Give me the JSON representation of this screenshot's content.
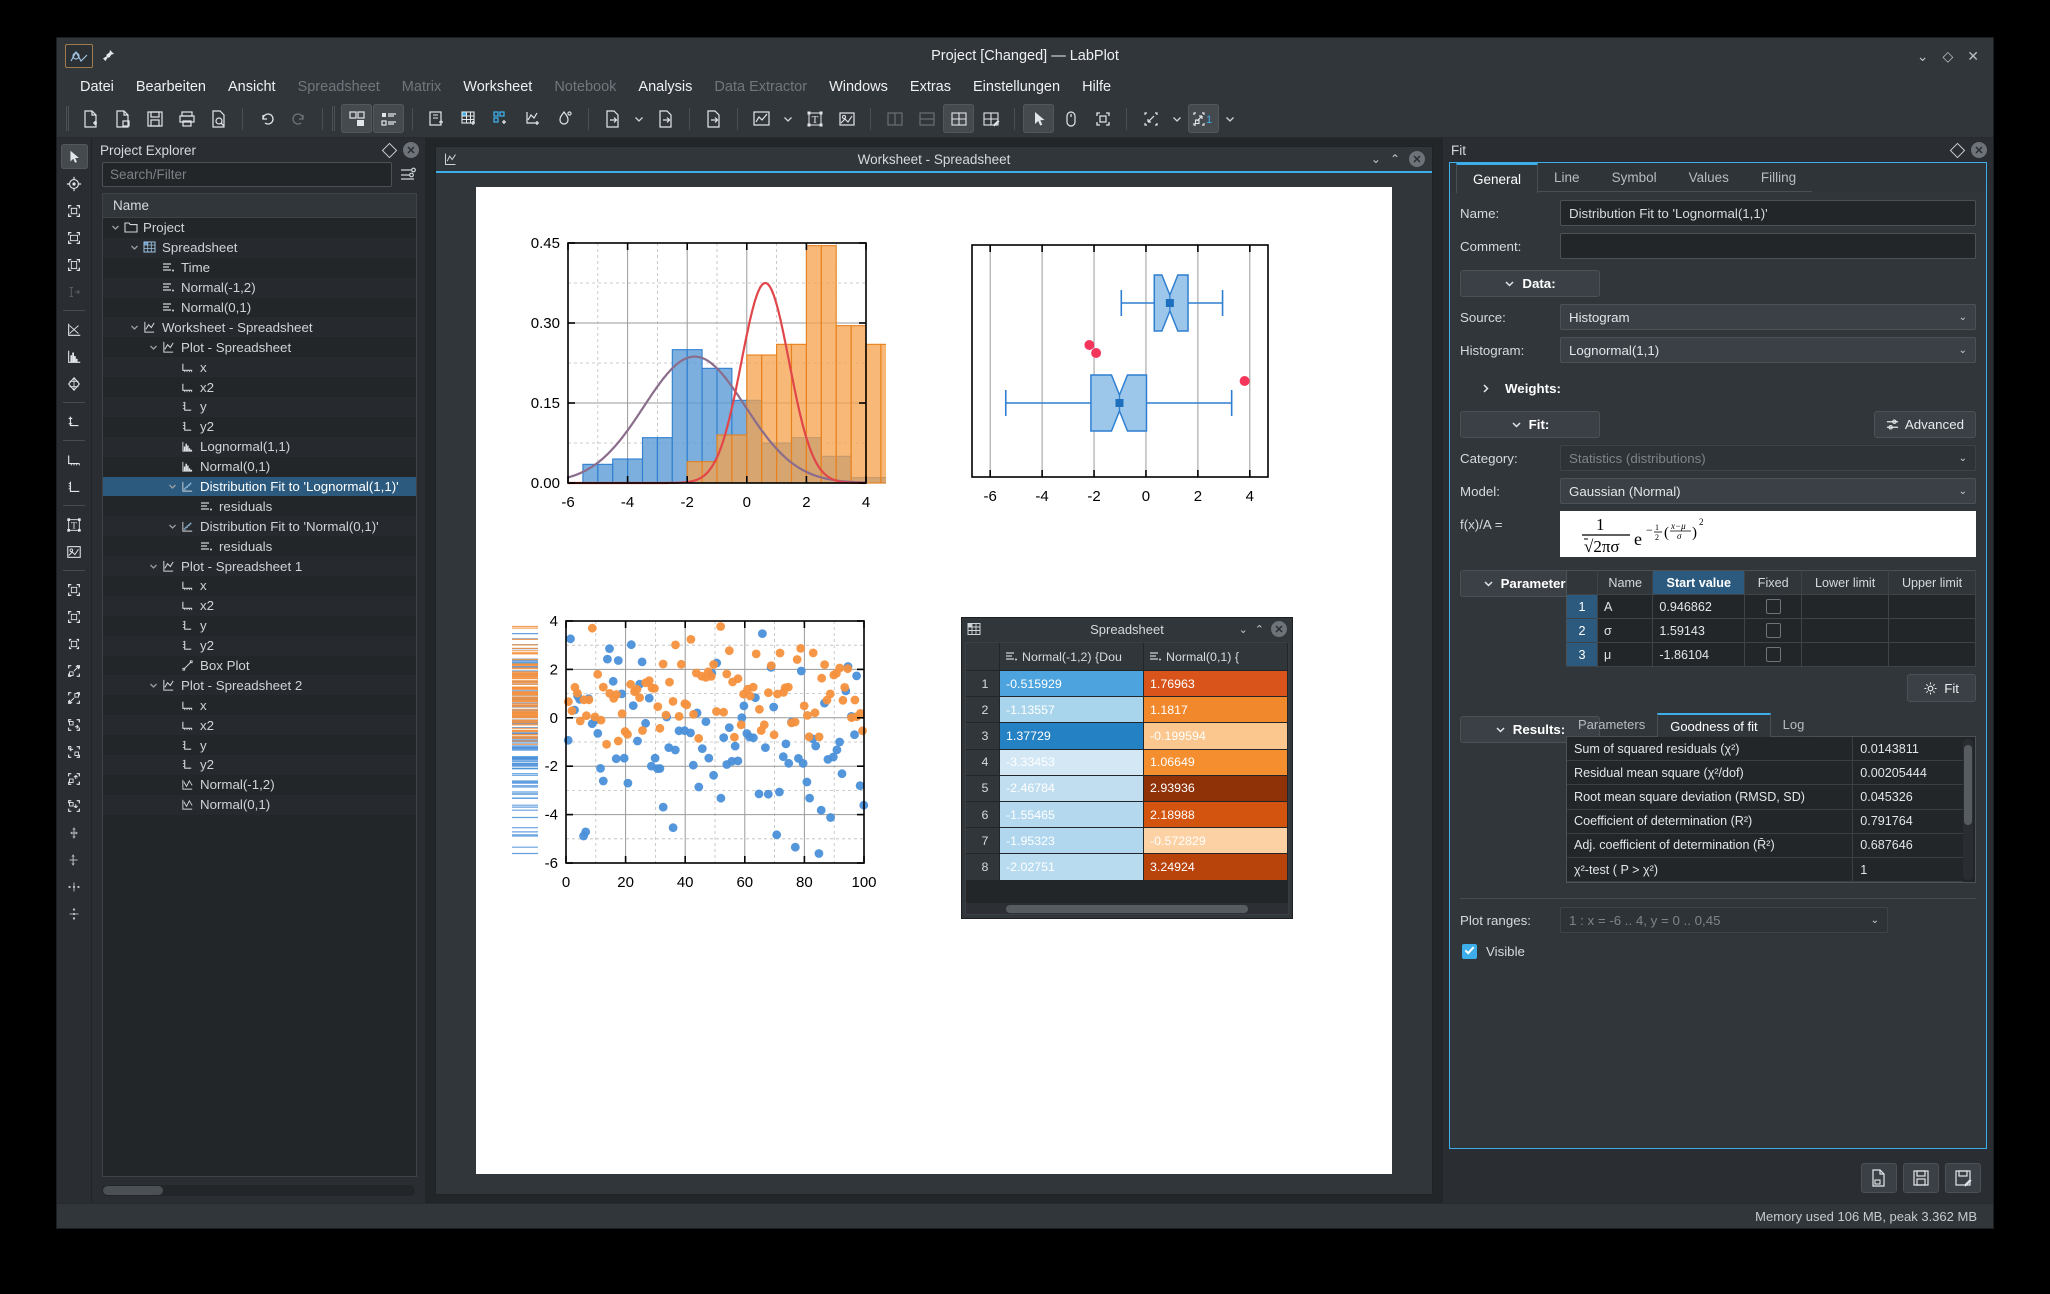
{
  "window": {
    "title": "Project [Changed] — LabPlot",
    "logo_icon": "labplot-logo-icon",
    "pin_icon": "pin-icon",
    "min_label": "⌄",
    "restore_label": "◇",
    "close_label": "✕"
  },
  "menubar": {
    "items": [
      {
        "label": "Datei",
        "enabled": true
      },
      {
        "label": "Bearbeiten",
        "enabled": true
      },
      {
        "label": "Ansicht",
        "enabled": true
      },
      {
        "label": "Spreadsheet",
        "enabled": false
      },
      {
        "label": "Matrix",
        "enabled": false
      },
      {
        "label": "Worksheet",
        "enabled": true
      },
      {
        "label": "Notebook",
        "enabled": false
      },
      {
        "label": "Analysis",
        "enabled": true
      },
      {
        "label": "Data Extractor",
        "enabled": false
      },
      {
        "label": "Windows",
        "enabled": true
      },
      {
        "label": "Extras",
        "enabled": true
      },
      {
        "label": "Einstellungen",
        "enabled": true
      },
      {
        "label": "Hilfe",
        "enabled": true
      }
    ]
  },
  "toolbar": {
    "items": [
      "new-project-icon",
      "open-project-icon",
      "save-icon",
      "print-icon",
      "print-preview-icon",
      "undo-icon",
      "redo-icon",
      "project-explorer-toggle-icon",
      "properties-explorer-toggle-icon",
      "new-workbook-icon",
      "new-spreadsheet-icon",
      "new-matrix-icon",
      "new-worksheet-icon",
      "new-notebook-icon",
      "import-file-icon",
      "import-dropdown-icon",
      "export-icon",
      "export-worksheet-icon",
      "add-plot-icon",
      "add-plot-dropdown-icon",
      "add-text-label-icon",
      "add-image-icon",
      "layout-vertical-icon",
      "layout-horizontal-icon",
      "layout-grid-icon",
      "layout-edit-icon",
      "select-mode-icon",
      "navigate-mode-icon",
      "zoom-select-mode-icon",
      "zoom-fit-icon",
      "zoom-fit-dropdown-icon",
      "magnification-icon",
      "magnification-dropdown-icon"
    ],
    "magnification_value": "1"
  },
  "left_toolbar": {
    "items": [
      "cursor-select-icon",
      "crosshair-icon",
      "select-region-icon",
      "select-x-region-icon",
      "select-y-region-icon",
      "text-cursor-icon",
      "add-xy-curve-icon",
      "add-histogram-icon",
      "add-qq-plot-icon",
      "add-bar-plot-icon",
      "add-axis-horizontal-icon",
      "add-axis-vertical-icon",
      "add-text-label-icon",
      "add-image-icon",
      "zoom-fit-icon",
      "zoom-in-icon",
      "zoom-out-icon",
      "shift-right-icon",
      "shift-left-icon",
      "shift-up-icon",
      "shift-down-icon",
      "expand-x-icon",
      "shrink-x-icon",
      "expand-y-icon",
      "shrink-y-icon",
      "align-center-icon",
      "align-middle-icon",
      "distribute-h-icon",
      "distribute-v-icon"
    ]
  },
  "project_explorer": {
    "title": "Project Explorer",
    "search_placeholder": "Search/Filter",
    "filter_icon": "filter-options-icon",
    "column_header": "Name",
    "tree": [
      {
        "label": "Project",
        "depth": 0,
        "icon": "folder-icon",
        "expander": "down",
        "selected": false
      },
      {
        "label": "Spreadsheet",
        "depth": 1,
        "icon": "spreadsheet-icon",
        "expander": "down",
        "selected": false
      },
      {
        "label": "Time",
        "depth": 2,
        "icon": "column-icon",
        "expander": "",
        "selected": false
      },
      {
        "label": "Normal(-1,2)",
        "depth": 2,
        "icon": "column-icon",
        "expander": "",
        "selected": false
      },
      {
        "label": "Normal(0,1)",
        "depth": 2,
        "icon": "column-icon",
        "expander": "",
        "selected": false
      },
      {
        "label": "Worksheet - Spreadsheet",
        "depth": 1,
        "icon": "worksheet-icon",
        "expander": "down",
        "selected": false
      },
      {
        "label": "Plot - Spreadsheet",
        "depth": 2,
        "icon": "plot-icon",
        "expander": "down",
        "selected": false
      },
      {
        "label": "x",
        "depth": 3,
        "icon": "axis-h-icon",
        "expander": "",
        "selected": false
      },
      {
        "label": "x2",
        "depth": 3,
        "icon": "axis-h-icon",
        "expander": "",
        "selected": false
      },
      {
        "label": "y",
        "depth": 3,
        "icon": "axis-v-icon",
        "expander": "",
        "selected": false
      },
      {
        "label": "y2",
        "depth": 3,
        "icon": "axis-v-icon",
        "expander": "",
        "selected": false
      },
      {
        "label": "Lognormal(1,1)",
        "depth": 3,
        "icon": "histogram-icon",
        "expander": "",
        "selected": false
      },
      {
        "label": "Normal(0,1)",
        "depth": 3,
        "icon": "histogram-icon",
        "expander": "",
        "selected": false
      },
      {
        "label": "Distribution Fit to 'Lognormal(1,1)'",
        "depth": 3,
        "icon": "fit-curve-icon",
        "expander": "down",
        "selected": true
      },
      {
        "label": "residuals",
        "depth": 4,
        "icon": "column-icon",
        "expander": "",
        "selected": false
      },
      {
        "label": "Distribution Fit to 'Normal(0,1)'",
        "depth": 3,
        "icon": "fit-curve-icon",
        "expander": "down",
        "selected": false
      },
      {
        "label": "residuals",
        "depth": 4,
        "icon": "column-icon",
        "expander": "",
        "selected": false
      },
      {
        "label": "Plot - Spreadsheet 1",
        "depth": 2,
        "icon": "plot-icon",
        "expander": "down",
        "selected": false
      },
      {
        "label": "x",
        "depth": 3,
        "icon": "axis-h-icon",
        "expander": "",
        "selected": false
      },
      {
        "label": "x2",
        "depth": 3,
        "icon": "axis-h-icon",
        "expander": "",
        "selected": false
      },
      {
        "label": "y",
        "depth": 3,
        "icon": "axis-v-icon",
        "expander": "",
        "selected": false
      },
      {
        "label": "y2",
        "depth": 3,
        "icon": "axis-v-icon",
        "expander": "",
        "selected": false
      },
      {
        "label": "Box Plot",
        "depth": 3,
        "icon": "box-plot-icon",
        "expander": "",
        "selected": false
      },
      {
        "label": "Plot - Spreadsheet 2",
        "depth": 2,
        "icon": "plot-icon",
        "expander": "down",
        "selected": false
      },
      {
        "label": "x",
        "depth": 3,
        "icon": "axis-h-icon",
        "expander": "",
        "selected": false
      },
      {
        "label": "x2",
        "depth": 3,
        "icon": "axis-h-icon",
        "expander": "",
        "selected": false
      },
      {
        "label": "y",
        "depth": 3,
        "icon": "axis-v-icon",
        "expander": "",
        "selected": false
      },
      {
        "label": "y2",
        "depth": 3,
        "icon": "axis-v-icon",
        "expander": "",
        "selected": false
      },
      {
        "label": "Normal(-1,2)",
        "depth": 3,
        "icon": "scatter-icon",
        "expander": "",
        "selected": false
      },
      {
        "label": "Normal(0,1)",
        "depth": 3,
        "icon": "scatter-icon",
        "expander": "",
        "selected": false
      }
    ]
  },
  "worksheet_window": {
    "title": "Worksheet - Spreadsheet",
    "icon": "worksheet-icon",
    "minimize": "⌄",
    "maximize": "⌃",
    "close": "✕"
  },
  "spreadsheet_window": {
    "title": "Spreadsheet",
    "icon": "spreadsheet-icon",
    "minimize": "⌄",
    "maximize": "⌃",
    "close": "✕",
    "columns": [
      "Normal(-1,2) {Dou",
      "Normal(0,1) {"
    ],
    "rows": [
      {
        "n": "1",
        "a": "-0.515929",
        "b": "1.76963",
        "ca": "#4ca3dd",
        "cb": "#d9541b",
        "ta": "#ffffff",
        "tb": "#ffffff"
      },
      {
        "n": "2",
        "a": "-1.13557",
        "b": "1.1817",
        "ca": "#a9d5ec",
        "cb": "#f2882c",
        "ta": "#ffffff",
        "tb": "#ffffff"
      },
      {
        "n": "3",
        "a": "1.37729",
        "b": "-0.199594",
        "ca": "#2481c4",
        "cb": "#fbc78e",
        "ta": "#ffffff",
        "tb": "#ffffff"
      },
      {
        "n": "4",
        "a": "-3.33453",
        "b": "1.06649",
        "ca": "#d3e7f4",
        "cb": "#f58e2e",
        "ta": "#ffffff",
        "tb": "#ffffff"
      },
      {
        "n": "5",
        "a": "-2.46784",
        "b": "2.93936",
        "ca": "#c0def0",
        "cb": "#8f3208",
        "ta": "#ffffff",
        "tb": "#ffffff"
      },
      {
        "n": "6",
        "a": "-1.55465",
        "b": "2.18988",
        "ca": "#b4d9ee",
        "cb": "#d2540f",
        "ta": "#ffffff",
        "tb": "#ffffff"
      },
      {
        "n": "7",
        "a": "-1.95323",
        "b": "-0.572829",
        "ca": "#b0d7ed",
        "cb": "#fcd1a4",
        "ta": "#ffffff",
        "tb": "#ffffff"
      },
      {
        "n": "8",
        "a": "-2.02751",
        "b": "3.24924",
        "ca": "#b8dbef",
        "cb": "#b8430b",
        "ta": "#ffffff",
        "tb": "#ffffff"
      }
    ]
  },
  "fit_panel": {
    "title": "Fit",
    "float_icon": "float-icon",
    "close_icon": "close-icon",
    "tabs": [
      {
        "label": "General",
        "active": true
      },
      {
        "label": "Line",
        "active": false
      },
      {
        "label": "Symbol",
        "active": false
      },
      {
        "label": "Values",
        "active": false
      },
      {
        "label": "Filling",
        "active": false
      }
    ],
    "name_label": "Name:",
    "name_value": "Distribution Fit to 'Lognormal(1,1)'",
    "comment_label": "Comment:",
    "comment_value": "",
    "data_section": "Data:",
    "source_label": "Source:",
    "source_value": "Histogram",
    "histogram_label": "Histogram:",
    "histogram_value": "Lognormal(1,1)",
    "weights_section": "Weights:",
    "fit_section": "Fit:",
    "advanced_label": "Advanced",
    "advanced_icon": "sliders-icon",
    "category_label": "Category:",
    "category_value": "Statistics (distributions)",
    "model_label": "Model:",
    "model_value": "Gaussian (Normal)",
    "formula_label": "f(x)/A =",
    "parameters_section": "Parameters:",
    "param_headers": [
      "Name",
      "Start value",
      "Fixed",
      "Lower limit",
      "Upper limit"
    ],
    "parameters": [
      {
        "idx": "1",
        "name": "A",
        "start": "0.946862",
        "fixed": false,
        "lower": "",
        "upper": ""
      },
      {
        "idx": "2",
        "name": "σ",
        "start": "1.59143",
        "fixed": false,
        "lower": "",
        "upper": ""
      },
      {
        "idx": "3",
        "name": "μ",
        "start": "-1.86104",
        "fixed": false,
        "lower": "",
        "upper": ""
      }
    ],
    "fit_button": "Fit",
    "fit_button_icon": "gear-icon",
    "results_section": "Results:",
    "result_tabs": [
      {
        "label": "Parameters",
        "active": false
      },
      {
        "label": "Goodness of fit",
        "active": true
      },
      {
        "label": "Log",
        "active": false
      }
    ],
    "goodness": [
      {
        "name": "Sum of squared residuals (χ²)",
        "value": "0.0143811"
      },
      {
        "name": "Residual mean square (χ²/dof)",
        "value": "0.00205444"
      },
      {
        "name": "Root mean square deviation (RMSD, SD)",
        "value": "0.045326"
      },
      {
        "name": "Coefficient of determination (R²)",
        "value": "0.791764"
      },
      {
        "name": "Adj. coefficient of determination (R̄²)",
        "value": "0.687646"
      },
      {
        "name": "χ²-test ( P > χ²)",
        "value": "1"
      }
    ],
    "plot_ranges_label": "Plot ranges:",
    "plot_ranges_value": "1 : x = -6 .. 4, y = 0 .. 0,45",
    "visible_label": "Visible",
    "visible_checked": true,
    "footer_buttons": [
      "load-from-file-icon",
      "save-icon",
      "save-as-template-icon"
    ]
  },
  "statusbar": {
    "text": "Memory used 106 MB, peak 3.362 MB"
  },
  "chart_data": [
    {
      "type": "bar",
      "title": "",
      "name": "histogram-with-distribution-fits",
      "xlabel": "",
      "ylabel": "",
      "xlim": [
        -6,
        4
      ],
      "ylim": [
        0,
        0.45
      ],
      "xticks": [
        -6,
        -4,
        -2,
        0,
        2,
        4
      ],
      "yticks": [
        0.0,
        0.15,
        0.3,
        0.45
      ],
      "ytick_labels": [
        "0.00",
        "0.15",
        "0.30",
        "0.45"
      ],
      "grid": true,
      "bin_width": 0.5,
      "series": [
        {
          "name": "Normal(-1,2)",
          "color": "#4a90d9",
          "type": "histogram",
          "bin_start": -5.5,
          "values": [
            0.035,
            0.035,
            0.045,
            0.045,
            0.085,
            0.085,
            0.25,
            0.25,
            0.215,
            0.215,
            0.155,
            0.155,
            0.075,
            0.075,
            0.085,
            0.085,
            0.05,
            0.05,
            0.01,
            0.01,
            0.01
          ]
        },
        {
          "name": "Lognormal(1,1)",
          "color": "#f5a14b",
          "type": "histogram",
          "bin_start": -2.0,
          "values": [
            0.04,
            0.04,
            0.09,
            0.09,
            0.24,
            0.24,
            0.26,
            0.26,
            0.445,
            0.445,
            0.295,
            0.295,
            0.26,
            0.26,
            0.09,
            0.09,
            0.115,
            0.115
          ]
        },
        {
          "name": "Distribution Fit to 'Normal(0,1)'",
          "color": "#8a6d8c",
          "type": "line",
          "fit": {
            "amplitude": 0.237,
            "mu": -1.75,
            "sigma": 1.7
          }
        },
        {
          "name": "Distribution Fit to 'Lognormal(1,1)'",
          "color": "#e0464a",
          "type": "line",
          "fit": {
            "amplitude": 0.375,
            "mu": 0.62,
            "sigma": 0.8
          }
        }
      ]
    },
    {
      "type": "box",
      "name": "box-plot",
      "xlim": [
        -6.7,
        4.7
      ],
      "xticks": [
        -6,
        -4,
        -2,
        0,
        2,
        4
      ],
      "grid": true,
      "boxes": [
        {
          "name": "Normal(0,1)",
          "row": "top",
          "whisker_low": -0.95,
          "q1": 0.32,
          "median": 0.92,
          "mean": 0.92,
          "q3": 1.62,
          "whisker_high": 2.95,
          "outliers": [
            -2.18,
            -1.92
          ],
          "fill": "#9dc7ea",
          "stroke": "#2f7fd1",
          "outlier_color": "#f5365c"
        },
        {
          "name": "Normal(-1,2)",
          "row": "bottom",
          "whisker_low": -5.4,
          "q1": -2.12,
          "median": -1.02,
          "mean": -1.02,
          "q3": 0.02,
          "whisker_high": 3.3,
          "outliers": [
            3.8
          ],
          "fill": "#9dc7ea",
          "stroke": "#2f7fd1",
          "outlier_color": "#f5365c"
        }
      ]
    },
    {
      "type": "scatter",
      "name": "scatter-plot-normal-distributions",
      "xlim": [
        0,
        100
      ],
      "ylim": [
        -6,
        4
      ],
      "xticks": [
        0,
        20,
        40,
        60,
        80,
        100
      ],
      "yticks": [
        -6,
        -4,
        -2,
        0,
        2,
        4
      ],
      "grid": true,
      "rug_axis": "y",
      "series": [
        {
          "name": "Normal(-1,2)",
          "color": "#4a90d9",
          "n": 100
        },
        {
          "name": "Normal(0,1)",
          "color": "#f5913e",
          "n": 100
        }
      ]
    }
  ]
}
